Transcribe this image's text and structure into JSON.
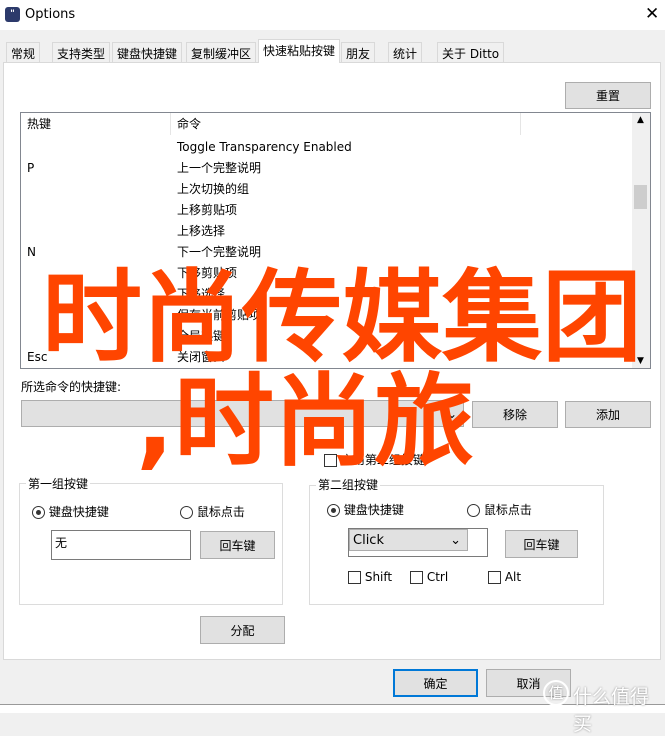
{
  "window": {
    "title": "Options",
    "close": "✕"
  },
  "tabs": [
    "常规",
    "支持类型",
    "键盘快捷键",
    "复制缓冲区",
    "快速粘贴按键",
    "朋友",
    "统计",
    "关于 Ditto"
  ],
  "active_tab": "快速粘贴按键",
  "reset_button": "重置",
  "list": {
    "headers": [
      "热键",
      "命令"
    ],
    "rows": [
      {
        "key": "",
        "cmd": "Toggle Transparency Enabled"
      },
      {
        "key": "P",
        "cmd": "上一个完整说明"
      },
      {
        "key": "",
        "cmd": "上次切换的组"
      },
      {
        "key": "",
        "cmd": "上移剪贴项"
      },
      {
        "key": "",
        "cmd": "上移选择"
      },
      {
        "key": "N",
        "cmd": "下一个完整说明"
      },
      {
        "key": "",
        "cmd": "下移剪贴项"
      },
      {
        "key": "",
        "cmd": "下移选择"
      },
      {
        "key": "",
        "cmd": "保存当前剪贴项"
      },
      {
        "key": "",
        "cmd": "全局热键"
      },
      {
        "key": "Esc",
        "cmd": "关闭窗口"
      }
    ]
  },
  "selected_label": "所选命令的快捷键:",
  "remove_button": "移除",
  "add_button": "添加",
  "enable_second": "启用第二组按键",
  "group1": {
    "title": "第一组按键",
    "radio_keyboard": "键盘快捷键",
    "radio_mouse": "鼠标点击",
    "key_value": "无",
    "enter_button": "回车键"
  },
  "group2": {
    "title": "第二组按键",
    "radio_keyboard": "键盘快捷键",
    "radio_mouse": "鼠标点击",
    "combo_value": "Click",
    "enter_button": "回车键",
    "shift": "Shift",
    "ctrl": "Ctrl",
    "alt": "Alt"
  },
  "assign_button": "分配",
  "ok_button": "确定",
  "cancel_button": "取消",
  "overlay": {
    "line1": "时尚传媒集团",
    "line2": ",时尚旅",
    "color": "#ff4500"
  },
  "watermark": {
    "badge": "值",
    "text": "什么值得买"
  }
}
